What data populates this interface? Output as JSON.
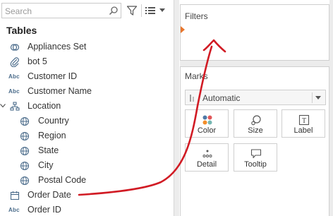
{
  "search": {
    "placeholder": "Search"
  },
  "data_pane": {
    "heading": "Tables",
    "fields": [
      {
        "label": "Appliances Set",
        "icon": "set-icon"
      },
      {
        "label": "bot 5",
        "icon": "group-clip-icon"
      },
      {
        "label": "Customer ID",
        "icon": "abc-string-icon",
        "abc": "Abc"
      },
      {
        "label": "Customer Name",
        "icon": "abc-string-icon",
        "abc": "Abc"
      },
      {
        "label": "Location",
        "icon": "hierarchy-icon"
      },
      {
        "label": "Country",
        "icon": "globe-icon"
      },
      {
        "label": "Region",
        "icon": "globe-icon"
      },
      {
        "label": "State",
        "icon": "globe-icon"
      },
      {
        "label": "City",
        "icon": "globe-icon"
      },
      {
        "label": "Postal Code",
        "icon": "globe-icon"
      },
      {
        "label": "Order Date",
        "icon": "calendar-icon"
      },
      {
        "label": "Order ID",
        "icon": "abc-string-icon",
        "abc": "Abc"
      }
    ]
  },
  "filters": {
    "title": "Filters"
  },
  "marks": {
    "title": "Marks",
    "type": {
      "value": "Automatic"
    },
    "buttons": [
      {
        "label": "Color",
        "icon": "color-dots-icon"
      },
      {
        "label": "Size",
        "icon": "size-icon"
      },
      {
        "label": "Label",
        "icon": "label-icon",
        "glyph": "T"
      },
      {
        "label": "Detail",
        "icon": "detail-icon"
      },
      {
        "label": "Tooltip",
        "icon": "tooltip-icon"
      }
    ]
  },
  "colors": {
    "accent_orange": "#e8762d",
    "field_icon_blue": "#4a6b8a",
    "annotation_red": "#d11b24"
  }
}
